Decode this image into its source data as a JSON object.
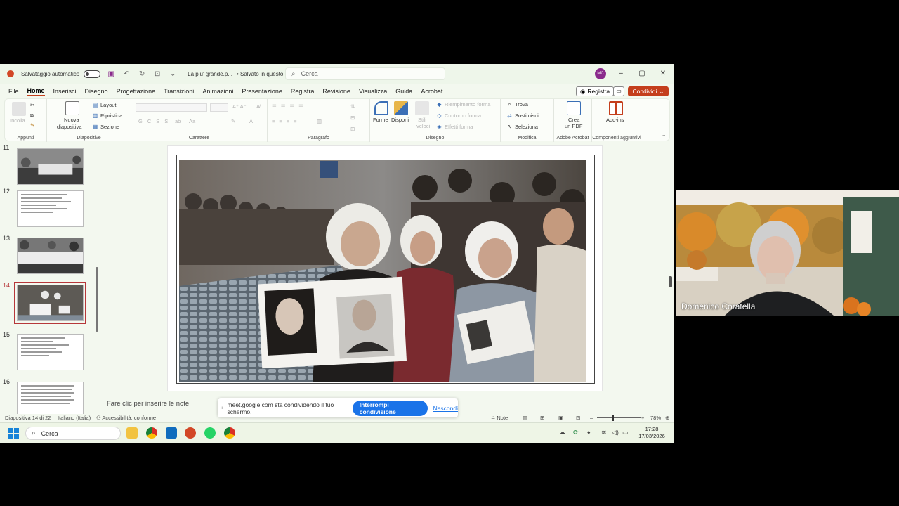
{
  "titlebar": {
    "autosave_label": "Salvataggio automatico",
    "document": "La piu' grande.p...",
    "save_status": "• Salvato in questo PC ⌄",
    "search_placeholder": "Cerca",
    "avatar_initials": "MC"
  },
  "tabs": [
    "File",
    "Home",
    "Inserisci",
    "Disegno",
    "Progettazione",
    "Transizioni",
    "Animazioni",
    "Presentazione",
    "Registra",
    "Revisione",
    "Visualizza",
    "Guida",
    "Acrobat"
  ],
  "active_tab": "Home",
  "actions": {
    "registra": "Registra",
    "condividi": "Condividi"
  },
  "ribbon": {
    "appunti": {
      "label": "Appunti",
      "paste": "Incolla"
    },
    "diapositive": {
      "label": "Diapositive",
      "new_slide_1": "Nuova",
      "new_slide_2": "diapositiva",
      "layout": "Layout",
      "reset": "Ripristina",
      "section": "Sezione"
    },
    "carattere": {
      "label": "Carattere"
    },
    "paragrafo": {
      "label": "Paragrafo"
    },
    "disegno": {
      "label": "Disegno",
      "forme": "Forme",
      "disponi": "Disponi",
      "stili_1": "Stili",
      "stili_2": "veloci",
      "riempimento": "Riempimento forma",
      "contorno": "Contorno forma",
      "effetti": "Effetti forma"
    },
    "modifica": {
      "label": "Modifica",
      "trova": "Trova",
      "sostituisci": "Sostituisci",
      "seleziona": "Seleziona"
    },
    "adobe": {
      "label": "Adobe Acrobat",
      "crea_1": "Crea",
      "crea_2": "un PDF"
    },
    "componenti": {
      "label": "Componenti aggiuntivi",
      "addins": "Add-ins"
    }
  },
  "slides": [
    {
      "num": "11",
      "type": "photo"
    },
    {
      "num": "12",
      "type": "text"
    },
    {
      "num": "13",
      "type": "photo"
    },
    {
      "num": "14",
      "type": "photo",
      "selected": true
    },
    {
      "num": "15",
      "type": "text"
    },
    {
      "num": "16",
      "type": "text"
    }
  ],
  "notes_placeholder": "Fare clic per inserire le note",
  "share_bar": {
    "message": "meet.google.com sta condividendo il tuo schermo.",
    "stop": "Interrompi condivisione",
    "hide": "Nascondi"
  },
  "statusbar": {
    "slide_info": "Diapositiva 14 di 22",
    "language": "Italiano (Italia)",
    "accessibility": "Accessibilità: conforme",
    "notes": "Note",
    "zoom": "78%"
  },
  "taskbar": {
    "search": "Cerca",
    "time": "17:28",
    "date": "17/03/2026"
  },
  "video": {
    "participant": "Domenico Coratella"
  },
  "colors": {
    "accent": "#c43e1c",
    "share_blue": "#1a73e8"
  }
}
